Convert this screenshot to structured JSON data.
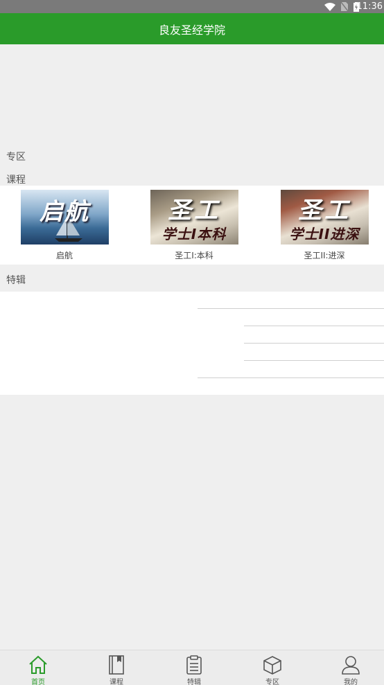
{
  "status": {
    "time": "11:36",
    "icons": [
      "wifi-icon",
      "no-sim-icon",
      "battery-charging-icon"
    ]
  },
  "header": {
    "title": "良友圣经学院"
  },
  "sections": {
    "zone_label": "专区",
    "courses_label": "课程",
    "features_label": "特辑"
  },
  "courses": [
    {
      "caption": "启航",
      "thumb_text": "启航",
      "thumb_sub": ""
    },
    {
      "caption": "圣工I:本科",
      "thumb_text": "圣工",
      "thumb_sub": "学士I本科"
    },
    {
      "caption": "圣工II:进深",
      "thumb_text": "圣工",
      "thumb_sub": "学士II进深"
    }
  ],
  "tabs": [
    {
      "label": "首页",
      "icon": "home-icon",
      "active": true
    },
    {
      "label": "课程",
      "icon": "book-icon",
      "active": false
    },
    {
      "label": "特辑",
      "icon": "clipboard-icon",
      "active": false
    },
    {
      "label": "专区",
      "icon": "cube-icon",
      "active": false
    },
    {
      "label": "我的",
      "icon": "user-icon",
      "active": false
    }
  ],
  "colors": {
    "primary": "#2a9b2a",
    "background": "#efefef"
  }
}
